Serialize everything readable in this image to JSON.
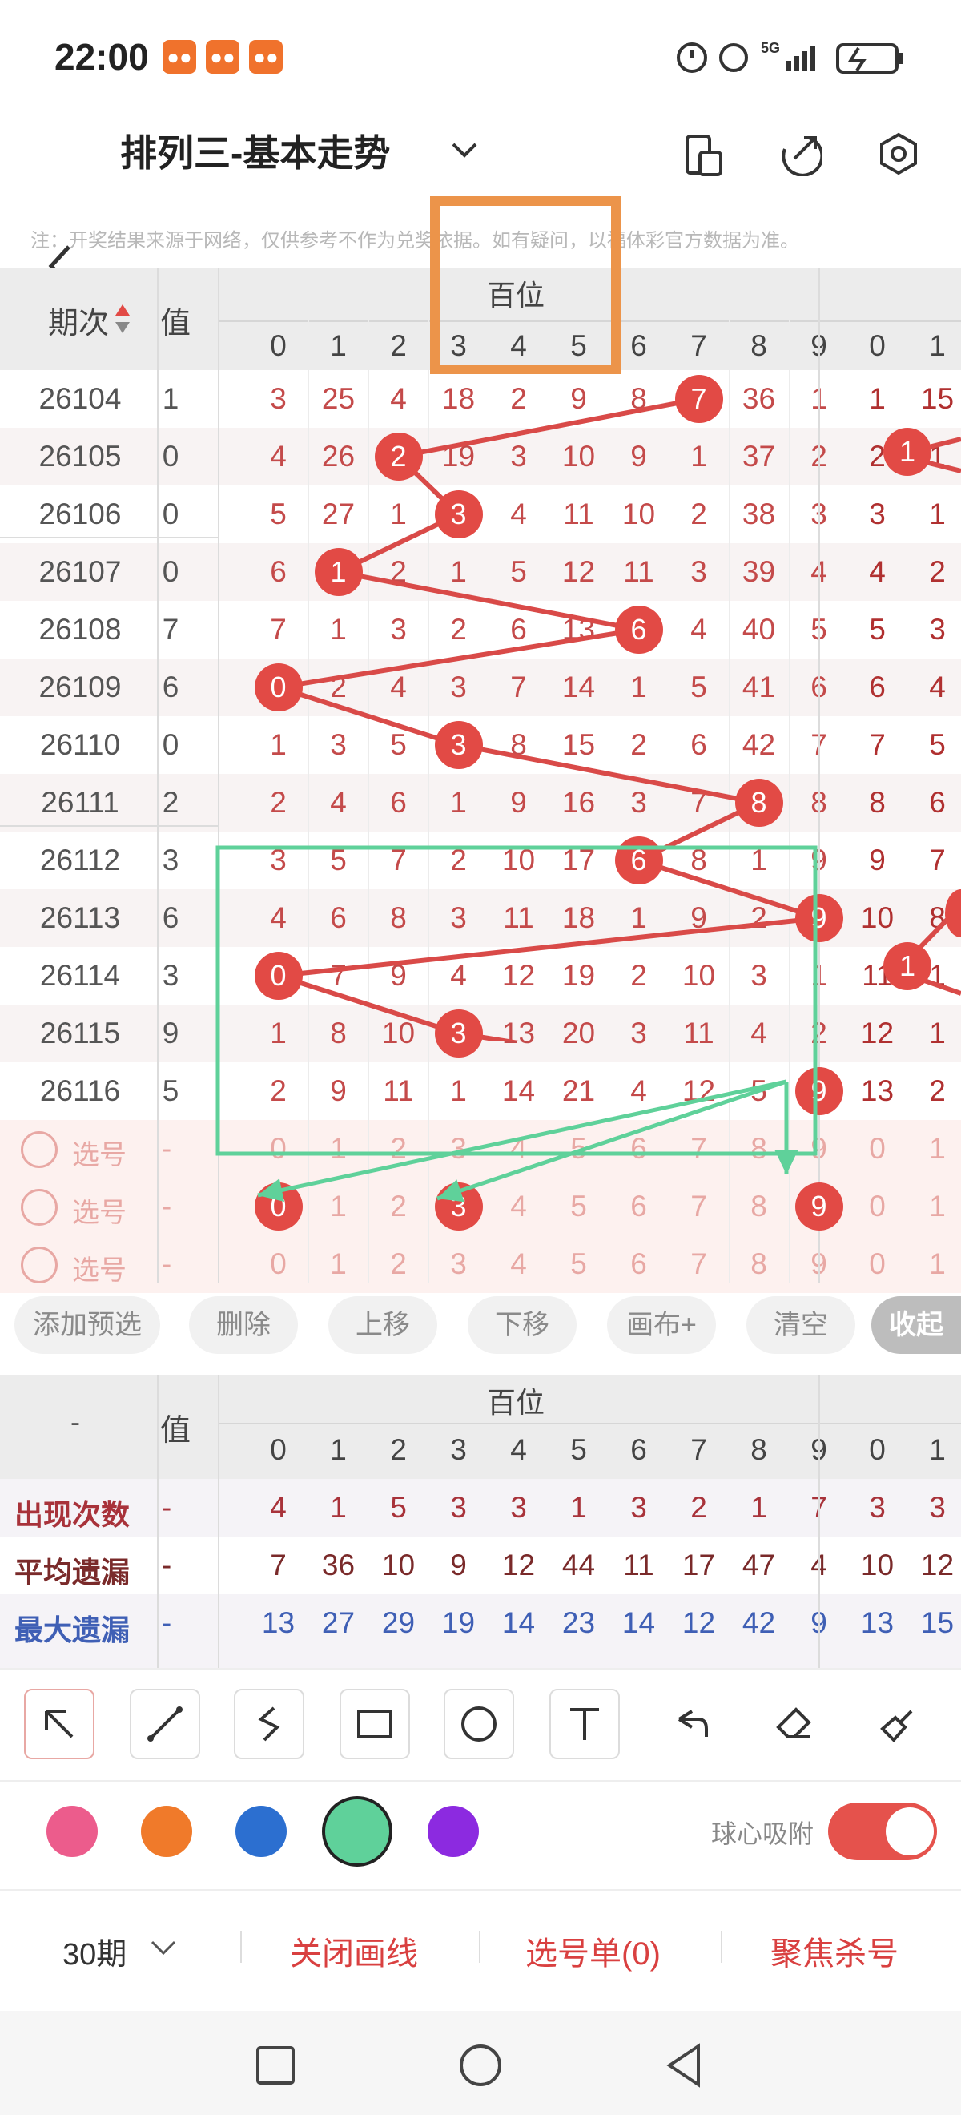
{
  "status": {
    "time": "22:00",
    "signal_label": "5G",
    "notif_icons": [
      "chat-icon",
      "chat-icon",
      "chat-icon"
    ]
  },
  "header": {
    "title": "排列三-基本走势",
    "icons": [
      "chevron-down-icon",
      "phone-layout-icon",
      "share-icon",
      "settings-icon"
    ]
  },
  "notice": "注：开奖结果来源于网络，仅供参考不作为兑奖依据。如有疑问，以福体彩官方数据为准。",
  "table": {
    "period_header": "期次",
    "value_header": "值",
    "group_label": "百位",
    "digits": [
      "0",
      "1",
      "2",
      "3",
      "4",
      "5",
      "6",
      "7",
      "8",
      "9"
    ],
    "next_digits": [
      "0",
      "1"
    ],
    "rows": [
      {
        "period": "26104",
        "value": "1",
        "cells": [
          "3",
          "25",
          "4",
          "18",
          "2",
          "9",
          "8",
          "7",
          "36",
          "1"
        ],
        "next": [
          "1",
          "15"
        ],
        "hit": 7
      },
      {
        "period": "26105",
        "value": "0",
        "cells": [
          "4",
          "26",
          "2",
          "19",
          "3",
          "10",
          "9",
          "1",
          "37",
          "2"
        ],
        "next": [
          "2",
          "1"
        ],
        "hit": 2
      },
      {
        "period": "26106",
        "value": "0",
        "cells": [
          "5",
          "27",
          "1",
          "3",
          "4",
          "11",
          "10",
          "2",
          "38",
          "3"
        ],
        "next": [
          "3",
          "1"
        ],
        "hit": 3
      },
      {
        "period": "26107",
        "value": "0",
        "cells": [
          "6",
          "1",
          "2",
          "1",
          "5",
          "12",
          "11",
          "3",
          "39",
          "4"
        ],
        "next": [
          "4",
          "2"
        ],
        "hit": 1
      },
      {
        "period": "26108",
        "value": "7",
        "cells": [
          "7",
          "1",
          "3",
          "2",
          "6",
          "13",
          "6",
          "4",
          "40",
          "5"
        ],
        "next": [
          "5",
          "3"
        ],
        "hit": 6
      },
      {
        "period": "26109",
        "value": "6",
        "cells": [
          "0",
          "2",
          "4",
          "3",
          "7",
          "14",
          "1",
          "5",
          "41",
          "6"
        ],
        "next": [
          "6",
          "4"
        ],
        "hit": 0
      },
      {
        "period": "26110",
        "value": "0",
        "cells": [
          "1",
          "3",
          "5",
          "3",
          "8",
          "15",
          "2",
          "6",
          "42",
          "7"
        ],
        "next": [
          "7",
          "5"
        ],
        "hit": 3
      },
      {
        "period": "26111",
        "value": "2",
        "cells": [
          "2",
          "4",
          "6",
          "1",
          "9",
          "16",
          "3",
          "7",
          "8",
          "8"
        ],
        "next": [
          "8",
          "6"
        ],
        "hit": 8
      },
      {
        "period": "26112",
        "value": "3",
        "cells": [
          "3",
          "5",
          "7",
          "2",
          "10",
          "17",
          "6",
          "8",
          "1",
          "9"
        ],
        "next": [
          "9",
          "7"
        ],
        "hit": 6
      },
      {
        "period": "26113",
        "value": "6",
        "cells": [
          "4",
          "6",
          "8",
          "3",
          "11",
          "18",
          "1",
          "9",
          "2",
          "9"
        ],
        "next": [
          "10",
          "8"
        ],
        "hit": 9
      },
      {
        "period": "26114",
        "value": "3",
        "cells": [
          "0",
          "7",
          "9",
          "4",
          "12",
          "19",
          "2",
          "10",
          "3",
          "1"
        ],
        "next": [
          "11",
          "1"
        ],
        "hit": 0
      },
      {
        "period": "26115",
        "value": "9",
        "cells": [
          "1",
          "8",
          "10",
          "3",
          "13",
          "20",
          "3",
          "11",
          "4",
          "2"
        ],
        "next": [
          "12",
          "1"
        ],
        "hit": 3
      },
      {
        "period": "26116",
        "value": "5",
        "cells": [
          "2",
          "9",
          "11",
          "1",
          "14",
          "21",
          "4",
          "12",
          "5",
          "9"
        ],
        "next": [
          "13",
          "2"
        ],
        "hit": 9
      }
    ],
    "select_rows": [
      {
        "label": "选号",
        "value": "-",
        "picked": []
      },
      {
        "label": "选号",
        "value": "-",
        "picked": [
          0,
          3,
          9
        ]
      },
      {
        "label": "选号",
        "value": "-",
        "picked": []
      }
    ]
  },
  "actions": [
    "添加预选",
    "删除",
    "上移",
    "下移",
    "画布+",
    "清空",
    "收起"
  ],
  "stats": {
    "dash": "-",
    "value_header": "值",
    "group_label": "百位",
    "rows": [
      {
        "label": "出现次数",
        "value": "-",
        "cells": [
          "4",
          "1",
          "5",
          "3",
          "3",
          "1",
          "3",
          "2",
          "1",
          "7"
        ],
        "next": [
          "3",
          "3"
        ],
        "color": "#a8323a"
      },
      {
        "label": "平均遗漏",
        "value": "-",
        "cells": [
          "7",
          "36",
          "10",
          "9",
          "12",
          "44",
          "11",
          "17",
          "47",
          "4"
        ],
        "next": [
          "10",
          "12"
        ],
        "color": "#7a2a2a"
      },
      {
        "label": "最大遗漏",
        "value": "-",
        "cells": [
          "13",
          "27",
          "29",
          "19",
          "14",
          "23",
          "14",
          "12",
          "42",
          "9"
        ],
        "next": [
          "13",
          "15"
        ],
        "color": "#3f5fb5"
      }
    ]
  },
  "tools": [
    "arrow-tool-icon",
    "line-tool-icon",
    "curve-tool-icon",
    "rectangle-tool-icon",
    "circle-tool-icon",
    "text-tool-icon",
    "undo-icon",
    "eraser-icon",
    "clear-brush-icon"
  ],
  "colors": [
    "#ec5c8c",
    "#f07a2a",
    "#2c6fd0",
    "#5fd19a",
    "#8c2ae0"
  ],
  "snap_label": "球心吸附",
  "snap_on": true,
  "bottom": {
    "period_select": "30期",
    "close_lines": "关闭画线",
    "pick_list": "选号单(0)",
    "focus_kill": "聚焦杀号"
  },
  "accent_red": "#d94040"
}
